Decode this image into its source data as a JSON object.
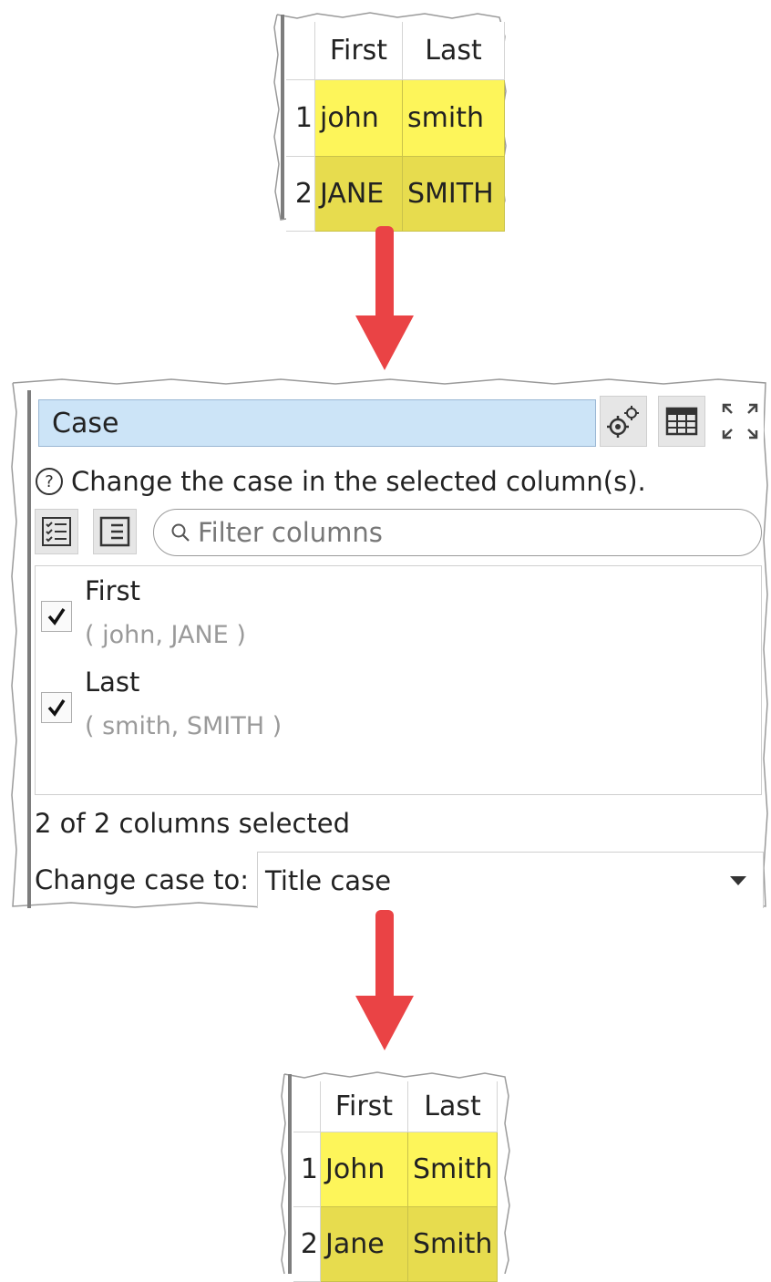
{
  "input_table": {
    "headers": [
      "First",
      "Last"
    ],
    "rows": [
      {
        "num": "1",
        "first": "john",
        "last": "smith"
      },
      {
        "num": "2",
        "first": "JANE",
        "last": "SMITH"
      }
    ]
  },
  "panel": {
    "title": "Case",
    "description": "Change the case in the selected column(s).",
    "filter_placeholder": "Filter columns",
    "columns": [
      {
        "name": "First",
        "sample": "( john, JANE )",
        "checked": true
      },
      {
        "name": "Last",
        "sample": "( smith, SMITH )",
        "checked": true
      }
    ],
    "status": "2 of 2 columns selected",
    "case_label": "Change case to:",
    "case_value": "Title case"
  },
  "output_table": {
    "headers": [
      "First",
      "Last"
    ],
    "rows": [
      {
        "num": "1",
        "first": "John",
        "last": "Smith"
      },
      {
        "num": "2",
        "first": "Jane",
        "last": "Smith"
      }
    ]
  },
  "colors": {
    "arrow": "#ea4345",
    "cell_row1": "#fdf55a",
    "cell_row2": "#e7dc4e",
    "title_bar": "#cce4f7"
  }
}
